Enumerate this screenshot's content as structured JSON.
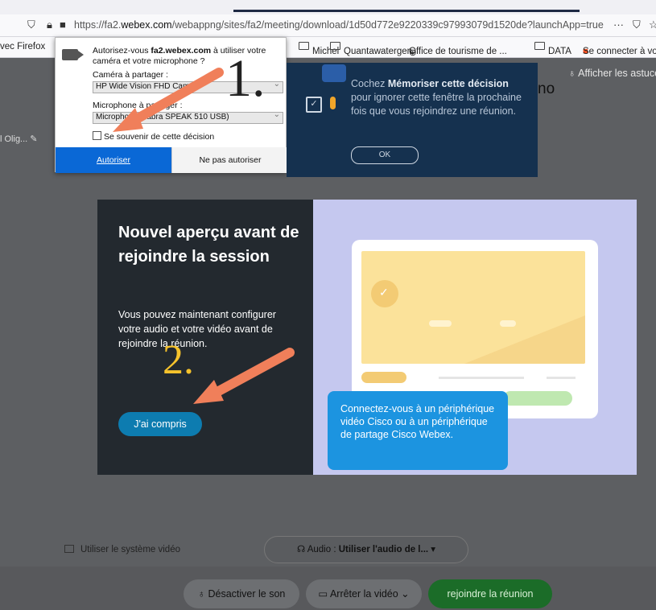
{
  "browser": {
    "url_prefix": "https://fa2.",
    "url_domain": "webex.com",
    "url_rest": "/webappng/sites/fa2/meeting/download/1d50d772e9220339c97993079d1520de?launchApp=true",
    "menu_glyph": "···",
    "bookmarks": [
      "vec Firefox",
      "Michel",
      "Quantawatergen",
      "Office de tourisme de ...",
      "DATA",
      "Se connecter à votre c..."
    ]
  },
  "permission": {
    "question_prefix": "Autorisez-vous ",
    "question_domain": "fa2.webex.com",
    "question_suffix": " à utiliser votre caméra et votre microphone ?",
    "camera_label": "Caméra à partager :",
    "camera_value": "HP Wide Vision FHD Cam",
    "mic_label": "Microphone à partager :",
    "mic_value": "Microphone (Jabra SPEAK 510 USB)",
    "remember_label": "Se souvenir de cette décision",
    "allow_label": "Autoriser",
    "deny_label": "Ne pas autoriser"
  },
  "tip": {
    "text_start": "Cochez ",
    "text_bold": "Mémoriser cette décision",
    "text_end": " pour ignorer cette fenêtre la prochaine fois que vous rejoindrez une réunion.",
    "ok_label": "OK"
  },
  "page": {
    "hint_label": "Afficher les astuces",
    "title_end": "no",
    "name_fragment": "l Olig..."
  },
  "onboarding": {
    "title": "Nouvel aperçu avant de rejoindre la session",
    "body": "Vous pouvez maintenant configurer votre audio et votre vidéo avant de rejoindre la réunion.",
    "button": "J'ai compris",
    "device_tip": "Connectez-vous à un périphérique vidéo Cisco ou à un périphérique de partage Cisco Webex."
  },
  "annotations": {
    "step1": "1.",
    "step2": "2.",
    "arrow_color": "#f07f5a"
  },
  "controls": {
    "system_video": "Utiliser le système vidéo",
    "audio_prefix": "Audio : ",
    "audio_value": "Utiliser l'audio de l...",
    "mute": "Désactiver le son",
    "stop_video": "Arrêter la vidéo",
    "join": "rejoindre la réunion"
  },
  "colors": {
    "join_green": "#1b6c28",
    "allow_blue": "#0a68d6",
    "tip_navy": "#15314f",
    "device_tip_blue": "#1c94e0"
  }
}
